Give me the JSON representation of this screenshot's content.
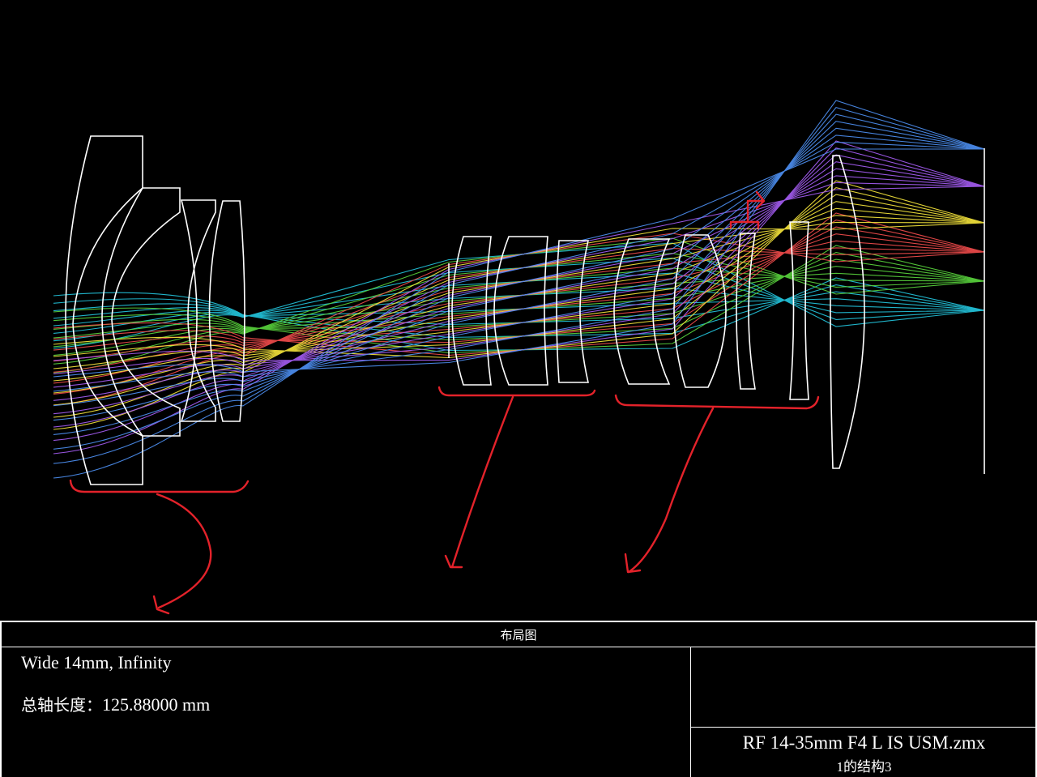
{
  "title_block": {
    "heading": "布局图",
    "config_line": "Wide 14mm, Infinity",
    "total_length_label": "总轴长度：",
    "total_length_value": "125.88000 mm",
    "file_name": "RF 14-35mm F4 L IS USM.zmx",
    "structure": "1的结构3"
  },
  "diagram": {
    "background": "#000000",
    "element_color": "#ffffff",
    "annotation_color": "#e3222a",
    "field_colors": [
      "#23c4dc",
      "#58d23c",
      "#ef4b4b",
      "#f3e33b",
      "#a35cf0",
      "#4d8ff0"
    ],
    "field_names": [
      "field-1-cyan",
      "field-2-green",
      "field-3-red",
      "field-4-yellow",
      "field-5-purple",
      "field-6-blue"
    ]
  }
}
